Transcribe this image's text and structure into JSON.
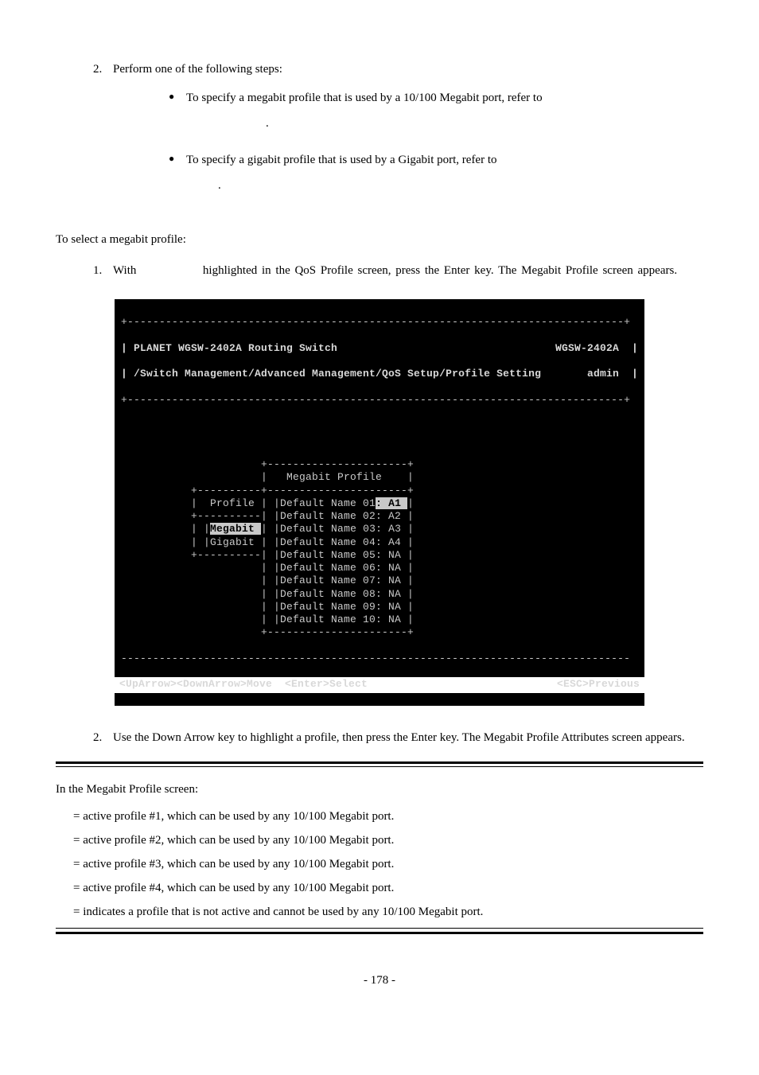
{
  "intro": {
    "step2": "Perform one of the following steps:",
    "bullet1": "To specify a megabit profile that is used by a 10/100 Megabit port, refer to",
    "bullet1_tail": ".",
    "bullet2": "To specify a gigabit profile that is used by a Gigabit port, refer to",
    "bullet2_tail": "."
  },
  "selectTitle": "To select a megabit profile:",
  "selectStep1_a": "With ",
  "selectStep1_b": " highlighted in the QoS Profile screen, press the Enter key. The Megabit Profile screen appears.",
  "terminal": {
    "line1_left": "| PLANET WGSW-2402A Routing Switch",
    "line1_right": "WGSW-2402A",
    "line2_left": "| /Switch Management/Advanced Management/QoS Setup/Profile Setting",
    "line2_right": "admin",
    "hdr": "|   Megabit Profile    |",
    "r01a": "|  Profile | |Default Name 01",
    "r01b": ": A1 ",
    "r01c": "|",
    "r02": "+----------| |Default Name 02: A2 |",
    "r03a": "| |",
    "r03b": "Megabit ",
    "r03c": "| |Default Name 03: A3 |",
    "r04": "| |Gigabit | |Default Name 04: A4 |",
    "r05": "+----------| |Default Name 05: NA |",
    "r06": "           | |Default Name 06: NA |",
    "r07": "           | |Default Name 07: NA |",
    "r08": "           | |Default Name 08: NA |",
    "r09": "           | |Default Name 09: NA |",
    "r10": "           | |Default Name 10: NA |",
    "ftr": "           +----------------------+",
    "nav_left": "<UpArrow><DownArrow>Move  <Enter>Select",
    "nav_right": "<ESC>Previous"
  },
  "step2below": "Use the Down Arrow key to highlight a profile, then press the Enter key. The Megabit Profile Attributes screen appears.",
  "noteTitle": "In the Megabit Profile screen:",
  "note1": " = active profile #1, which can be used by any 10/100 Megabit port.",
  "note2": " = active profile #2, which can be used by any 10/100 Megabit port.",
  "note3": " = active profile #3, which can be used by any 10/100 Megabit port.",
  "note4": " = active profile #4, which can be used by any 10/100 Megabit port.",
  "note5": " = indicates a profile that is not active and cannot be used by any 10/100 Megabit port.",
  "pageNum": "- 178 -"
}
